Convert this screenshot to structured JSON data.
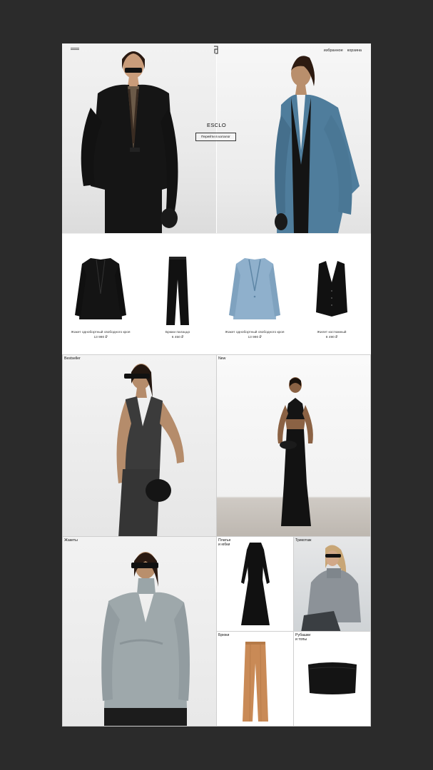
{
  "header": {
    "nav": [
      "избранное",
      "корзина"
    ]
  },
  "hero": {
    "title": "ESCLO",
    "cta_label": "Перейти в каталог"
  },
  "products": [
    {
      "name": "Жакет однобортный свободного кроя",
      "price": "13 990 ₽",
      "icon": "black-blazer"
    },
    {
      "name": "Брюки палаццо",
      "price": "6 450 ₽",
      "icon": "black-trousers"
    },
    {
      "name": "Жакет однобортный свободного кроя",
      "price": "13 990 ₽",
      "icon": "blue-blazer"
    },
    {
      "name": "Жилет костюмный",
      "price": "8 490 ₽",
      "icon": "black-vest"
    }
  ],
  "categories": {
    "bestseller": "Bestseller",
    "new": "New",
    "jackets": "Жакеты",
    "dresses": "Платье\nи юбки",
    "knitwear": "Трикотаж",
    "trousers": "Брюки",
    "shirts": "Рубашки\nи топы"
  },
  "colors": {
    "background": "#2b2b2b",
    "blue_blazer": "#4f7d9c",
    "light_blue": "#8fb0cc",
    "camel": "#c98a56"
  }
}
